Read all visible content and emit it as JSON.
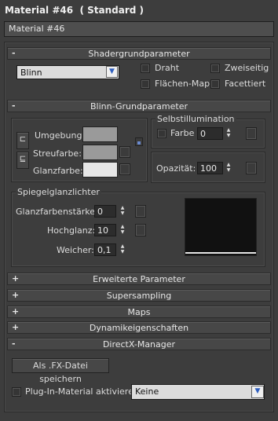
{
  "window": {
    "title": "Material #46  ( Standard )"
  },
  "material_name": "Material #46",
  "rollouts": {
    "shader": {
      "sign": "-",
      "label": "Shadergrundparameter"
    },
    "blinn": {
      "sign": "-",
      "label": "Blinn-Grundparameter"
    },
    "extended": {
      "sign": "+",
      "label": "Erweiterte Parameter"
    },
    "supersampling": {
      "sign": "+",
      "label": "Supersampling"
    },
    "maps": {
      "sign": "+",
      "label": "Maps"
    },
    "dynamics": {
      "sign": "+",
      "label": "Dynamikeigenschaften"
    },
    "directx": {
      "sign": "-",
      "label": "DirectX-Manager"
    }
  },
  "shader": {
    "selected": "Blinn",
    "options": [
      "Draht",
      "Zweiseitig",
      "Flächen-Map",
      "Facettiert"
    ]
  },
  "blinn": {
    "ambient_label": "Umgebung:",
    "diffuse_label": "Streufarbe:",
    "specular_label": "Glanzfarbe:",
    "selfillum_title": "Selbstillumination",
    "color_label": "Farbe",
    "color_value": "0",
    "opacity_label": "Opazität:",
    "opacity_value": "100",
    "highlights_title": "Spiegelglanzlichter",
    "spec_level_label": "Glanzfarbenstärke:",
    "spec_level_value": "0",
    "glossiness_label": "Hochglanz:",
    "glossiness_value": "10",
    "soften_label": "Weicher:",
    "soften_value": "0,1"
  },
  "directx": {
    "save_fx_label": "Als .FX-Datei speichern",
    "plugin_label": "Plug-In-Material aktivieren",
    "plugin_selected": "Keine"
  },
  "colors": {
    "ambient": "#9a9a9a",
    "diffuse": "#9a9a9a",
    "specular": "#e6e6e6",
    "highlight_preview": "#111111"
  }
}
